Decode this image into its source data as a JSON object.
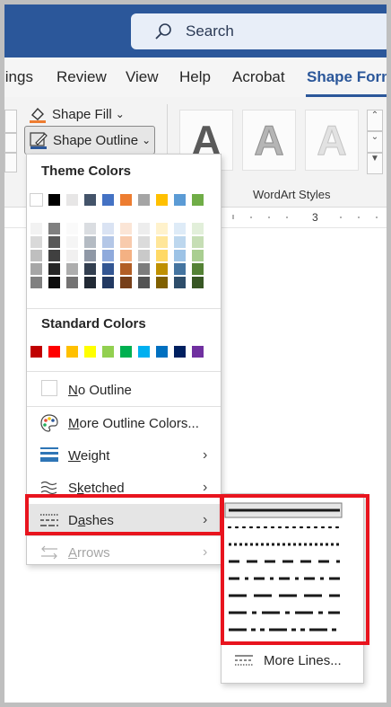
{
  "search": {
    "placeholder": "Search"
  },
  "tabs": [
    {
      "label": "lings"
    },
    {
      "label": "Review"
    },
    {
      "label": "View"
    },
    {
      "label": "Help"
    },
    {
      "label": "Acrobat"
    },
    {
      "label": "Shape Form",
      "active": true
    }
  ],
  "ribbon": {
    "shape_fill": "Shape Fill",
    "shape_outline": "Shape Outline",
    "wordart_glyph": "A",
    "wordart_label": "WordArt Styles",
    "ruler_number": "3"
  },
  "dropdown": {
    "theme_colors_title": "Theme Colors",
    "theme_colors": [
      "#ffffff",
      "#000000",
      "#e7e6e6",
      "#44546a",
      "#4472c4",
      "#ed7d31",
      "#a5a5a5",
      "#ffc000",
      "#5b9bd5",
      "#70ad47"
    ],
    "standard_colors_title": "Standard Colors",
    "standard_colors": [
      "#c00000",
      "#ff0000",
      "#ffc000",
      "#ffff00",
      "#92d050",
      "#00b050",
      "#00b0f0",
      "#0070c0",
      "#002060",
      "#7030a0"
    ],
    "items": [
      {
        "label": "No Outline",
        "icon": "empty-square-icon"
      },
      {
        "label": "More Outline Colors...",
        "icon": "palette-icon"
      },
      {
        "label": "Weight",
        "icon": "line-weight-icon"
      },
      {
        "label": "Sketched",
        "icon": "sketched-line-icon"
      },
      {
        "label": "Dashes",
        "icon": "dashes-icon",
        "highlighted": true
      },
      {
        "label": "Arrows",
        "icon": "arrows-icon",
        "disabled": true
      }
    ]
  },
  "dashes_submenu": {
    "styles": [
      "Solid",
      "Round Dot",
      "Square Dot",
      "Dash",
      "Dash Dot",
      "Long Dash",
      "Long Dash Dot",
      "Long Dash Dot Dot"
    ],
    "selected": "Solid",
    "more_lines": "More Lines..."
  },
  "colors": {
    "title_bar": "#2b579a",
    "accent": "#2b579a",
    "highlight_box": "#e8141e"
  }
}
